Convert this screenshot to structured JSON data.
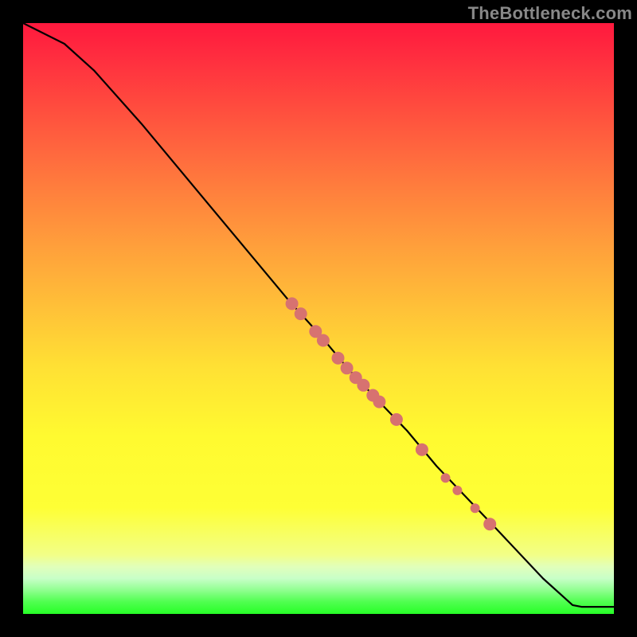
{
  "watermark": "TheBottleneck.com",
  "chart_data": {
    "type": "line",
    "title": "",
    "xlabel": "",
    "ylabel": "",
    "xlim": [
      0,
      100
    ],
    "ylim": [
      0,
      100
    ],
    "curve": [
      {
        "x": 0,
        "y": 100
      },
      {
        "x": 7,
        "y": 96.5
      },
      {
        "x": 12,
        "y": 92
      },
      {
        "x": 20,
        "y": 83
      },
      {
        "x": 30,
        "y": 71
      },
      {
        "x": 40,
        "y": 59
      },
      {
        "x": 45,
        "y": 53
      },
      {
        "x": 50,
        "y": 47.5
      },
      {
        "x": 55,
        "y": 41.5
      },
      {
        "x": 60,
        "y": 36.2
      },
      {
        "x": 65,
        "y": 31
      },
      {
        "x": 70,
        "y": 25
      },
      {
        "x": 80,
        "y": 14.5
      },
      {
        "x": 88,
        "y": 6
      },
      {
        "x": 93,
        "y": 1.5
      },
      {
        "x": 94.5,
        "y": 1.2
      },
      {
        "x": 100,
        "y": 1.2
      }
    ],
    "note": "x and y values are estimated percentages of the 742x742 plot area",
    "highlight_points": [
      {
        "x": 45.5,
        "y": 52.5,
        "r": 8
      },
      {
        "x": 47.0,
        "y": 50.8,
        "r": 8
      },
      {
        "x": 49.5,
        "y": 47.8,
        "r": 8
      },
      {
        "x": 50.8,
        "y": 46.3,
        "r": 8
      },
      {
        "x": 53.3,
        "y": 43.3,
        "r": 8
      },
      {
        "x": 54.8,
        "y": 41.6,
        "r": 8
      },
      {
        "x": 56.3,
        "y": 40.0,
        "r": 8
      },
      {
        "x": 57.6,
        "y": 38.7,
        "r": 8
      },
      {
        "x": 59.2,
        "y": 37.0,
        "r": 8
      },
      {
        "x": 60.3,
        "y": 35.9,
        "r": 8
      },
      {
        "x": 63.2,
        "y": 32.9,
        "r": 8
      },
      {
        "x": 67.5,
        "y": 27.8,
        "r": 8
      },
      {
        "x": 71.5,
        "y": 23.0,
        "r": 6
      },
      {
        "x": 73.5,
        "y": 20.9,
        "r": 6
      },
      {
        "x": 76.5,
        "y": 17.9,
        "r": 6
      },
      {
        "x": 79.0,
        "y": 15.2,
        "r": 8
      }
    ],
    "colors": {
      "line": "#000000",
      "point_fill": "#d77270",
      "point_stroke": "none"
    }
  }
}
